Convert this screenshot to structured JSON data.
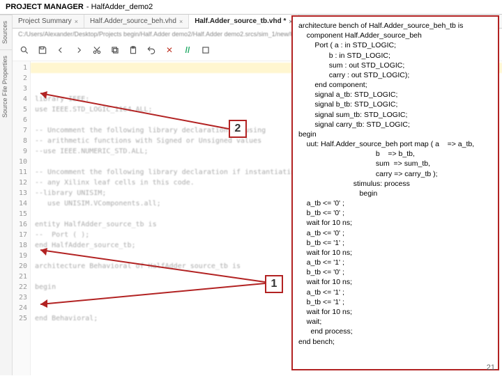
{
  "title": {
    "main": "PROJECT MANAGER",
    "sub": "- HalfAdder_demo2"
  },
  "sidetabs": [
    {
      "label": "Sources"
    },
    {
      "label": "Source File Properties"
    }
  ],
  "tabs": [
    {
      "label": "Project Summary",
      "active": false
    },
    {
      "label": "Half.Adder_source_beh.vhd",
      "active": false
    },
    {
      "label": "Half.Adder_source_tb.vhd *",
      "active": true
    }
  ],
  "path": "C:/Users/Alexander/Desktop/Projects begin/Half.Adder demo2/Half.Adder demo2.srcs/sim_1/new/Ha...",
  "toolbar": {
    "search": "search-icon",
    "save": "save-icon",
    "cut": "cut-icon",
    "copy": "copy-icon",
    "paste": "paste-icon",
    "undo": "undo-icon",
    "delete": "delete-icon",
    "comment": "//",
    "expand": "expand-icon"
  },
  "gutter": [
    "1",
    "2",
    "3",
    "4",
    "5",
    "6",
    "7",
    "8",
    "9",
    "10",
    "11",
    "12",
    "13",
    "14",
    "15",
    "16",
    "17",
    "18",
    "19",
    "20",
    "21",
    "22",
    "23",
    "24",
    "25"
  ],
  "code": [
    "",
    "",
    "",
    "library IEEE;",
    "use IEEE.STD_LOGIC_1164.ALL;",
    "",
    "-- Uncomment the following library declaration if using",
    "-- arithmetic functions with Signed or Unsigned values",
    "--use IEEE.NUMERIC_STD.ALL;",
    "",
    "-- Uncomment the following library declaration if instantiating",
    "-- any Xilinx leaf cells in this code.",
    "--library UNISIM;",
    "   use UNISIM.VComponents.all;",
    "",
    "entity HalfAdder_source_tb is",
    "--  Port ( );",
    "end HalfAdder_source_tb;",
    "",
    "architecture Behavioral of HalfAdder_source_tb is",
    "",
    "begin",
    "",
    "",
    "end Behavioral;"
  ],
  "callouts": {
    "c1": "1",
    "c2": "2"
  },
  "vhdl": [
    "architecture bench of Half.Adder_source_beh_tb is",
    "    component Half.Adder_source_beh",
    "        Port ( a : in STD_LOGIC;",
    "               b : in STD_LOGIC;",
    "               sum : out STD_LOGIC;",
    "               carry : out STD_LOGIC);",
    "        end component;",
    "        signal a_tb: STD_LOGIC;",
    "        signal b_tb: STD_LOGIC;",
    "        signal sum_tb: STD_LOGIC;",
    "        signal carry_tb: STD_LOGIC;",
    "begin",
    "    uut: Half.Adder_source_beh port map ( a    => a_tb,",
    "                                      b    => b_tb,",
    "                                      sum  => sum_tb,",
    "                                      carry => carry_tb );",
    "                           stimulus: process",
    "                              begin",
    "    a_tb <= '0' ;",
    "    b_tb <= '0' ;",
    "    wait for 10 ns;",
    "    a_tb <= '0' ;",
    "    b_tb <= '1' ;",
    "    wait for 10 ns;",
    "    a_tb <= '1' ;",
    "    b_tb <= '0' ;",
    "    wait for 10 ns;",
    "    a_tb <= '1' ;",
    "    b_tb <= '1' ;",
    "    wait for 10 ns;",
    "    wait;",
    "      end process;",
    "end bench;"
  ],
  "slide_no": "21"
}
